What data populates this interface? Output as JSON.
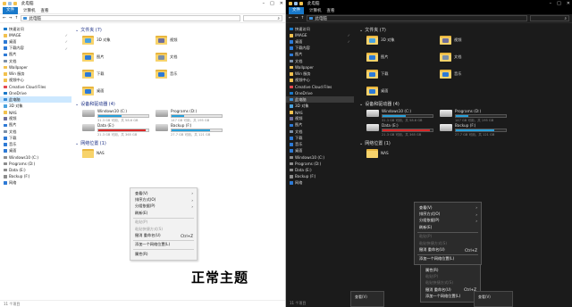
{
  "colors": {
    "accent": "#1979ca",
    "folder": "#f2c14e",
    "drive_bar": "#26a0da",
    "drive_bar_low": "#da2626"
  },
  "light": {
    "title": "此电脑",
    "ribbon_tabs": [
      "文件",
      "计算机",
      "查看"
    ],
    "address": "此电脑",
    "sidebar": [
      {
        "label": "快速访问",
        "icon": "star-icon",
        "color": "#1979ca",
        "pinned": false,
        "selected": false
      },
      {
        "label": "IMAGE",
        "icon": "folder-icon",
        "color": "#f2c14e",
        "pinned": true,
        "selected": false
      },
      {
        "label": "桌面",
        "icon": "desktop-icon",
        "color": "#2d7ad6",
        "pinned": true,
        "selected": false
      },
      {
        "label": "下载内容",
        "icon": "download-icon",
        "color": "#2d7ad6",
        "pinned": true,
        "selected": false
      },
      {
        "label": "图片",
        "icon": "pictures-icon",
        "color": "#2d7ad6",
        "pinned": false,
        "selected": false
      },
      {
        "label": "文档",
        "icon": "documents-icon",
        "color": "#7b8fa8",
        "pinned": false,
        "selected": false
      },
      {
        "label": "Wallpaper",
        "icon": "folder-icon",
        "color": "#f2c14e",
        "pinned": false,
        "selected": false
      },
      {
        "label": "Win 服务",
        "icon": "folder-icon",
        "color": "#f2c14e",
        "pinned": false,
        "selected": false
      },
      {
        "label": "视频中心",
        "icon": "folder-icon",
        "color": "#f2c14e",
        "pinned": false,
        "selected": false
      },
      {
        "label": "Creative Cloud Files",
        "icon": "creative-cloud-icon",
        "color": "#e34850",
        "pinned": false,
        "selected": false
      },
      {
        "label": "OneDrive",
        "icon": "cloud-icon",
        "color": "#1979ca",
        "pinned": false,
        "selected": false
      },
      {
        "label": "此电脑",
        "icon": "computer-icon",
        "color": "#3b8ed8",
        "pinned": false,
        "selected": true
      },
      {
        "label": "3D 对象",
        "icon": "3d-icon",
        "color": "#4aa3df",
        "pinned": false,
        "selected": false
      },
      {
        "label": "NAS",
        "icon": "folder-icon",
        "color": "#f2c14e",
        "pinned": false,
        "selected": false
      },
      {
        "label": "视频",
        "icon": "video-icon",
        "color": "#6f6f9c",
        "pinned": false,
        "selected": false
      },
      {
        "label": "图片",
        "icon": "pictures-icon",
        "color": "#2d7ad6",
        "pinned": false,
        "selected": false
      },
      {
        "label": "文档",
        "icon": "documents-icon",
        "color": "#7b8fa8",
        "pinned": false,
        "selected": false
      },
      {
        "label": "下载",
        "icon": "download-icon",
        "color": "#2d7ad6",
        "pinned": false,
        "selected": false
      },
      {
        "label": "音乐",
        "icon": "music-icon",
        "color": "#2d7ad6",
        "pinned": false,
        "selected": false
      },
      {
        "label": "桌面",
        "icon": "desktop-icon",
        "color": "#2d7ad6",
        "pinned": false,
        "selected": false
      },
      {
        "label": "Windows10 (C:)",
        "icon": "drive-icon",
        "color": "#8c8c8c",
        "pinned": false,
        "selected": false
      },
      {
        "label": "Programs (D:)",
        "icon": "drive-icon",
        "color": "#8c8c8c",
        "pinned": false,
        "selected": false
      },
      {
        "label": "Data (E:)",
        "icon": "drive-icon",
        "color": "#8c8c8c",
        "pinned": false,
        "selected": false
      },
      {
        "label": "Backup (F:)",
        "icon": "drive-icon",
        "color": "#8c8c8c",
        "pinned": false,
        "selected": false
      },
      {
        "label": "网络",
        "icon": "network-icon",
        "color": "#2d7ad6",
        "pinned": false,
        "selected": false
      }
    ],
    "folders_header": "文件夹 (7)",
    "folders": [
      {
        "label": "3D 对象",
        "glyph": "#4aa3df"
      },
      {
        "label": "视频",
        "glyph": "#6f6f9c"
      },
      {
        "label": "图片",
        "glyph": "#2d7ad6"
      },
      {
        "label": "文档",
        "glyph": "#7b8fa8"
      },
      {
        "label": "下载",
        "glyph": "#2d7ad6"
      },
      {
        "label": "音乐",
        "glyph": "#2d7ad6"
      },
      {
        "label": "桌面",
        "glyph": "#2d7ad6"
      }
    ],
    "drives_header": "设备和驱动器 (4)",
    "drives": [
      {
        "label": "Windows10 (C:)",
        "free": "31.3 GB 可用，共 58.6 GB",
        "fill": 0.47,
        "low": false
      },
      {
        "label": "Programs (D:)",
        "free": "147 GB 可用，共 195 GB",
        "fill": 0.25,
        "low": false
      },
      {
        "label": "Data (E:)",
        "free": "21.3 GB 可用，共 365 GB",
        "fill": 0.94,
        "low": true
      },
      {
        "label": "Backup (F:)",
        "free": "27.7 GB 可用，共 121 GB",
        "fill": 0.77,
        "low": false
      }
    ],
    "network_header": "网络位置 (1)",
    "network": [
      {
        "label": "NAS"
      }
    ],
    "status": "11 个项目",
    "context_menu": [
      {
        "label": "查看(V)",
        "sub": true,
        "disabled": false
      },
      {
        "label": "排序方式(O)",
        "sub": true,
        "disabled": false
      },
      {
        "label": "分组依据(P)",
        "sub": true,
        "disabled": false
      },
      {
        "label": "刷新(E)",
        "sub": false,
        "disabled": false
      },
      {
        "sep": true
      },
      {
        "label": "粘贴(P)",
        "sub": false,
        "disabled": true
      },
      {
        "label": "粘贴快捷方式(S)",
        "sub": false,
        "disabled": true
      },
      {
        "label": "撤消 重命名(U)",
        "shortcut": "Ctrl+Z",
        "sub": false,
        "disabled": false
      },
      {
        "sep": true
      },
      {
        "label": "添加一个网络位置(L)",
        "sub": false,
        "disabled": false
      },
      {
        "sep": true
      },
      {
        "label": "属性(R)",
        "sub": false,
        "disabled": false
      }
    ],
    "caption": "正常主题"
  },
  "dark": {
    "title": "此电脑",
    "ribbon_tabs": [
      "文件",
      "计算机",
      "查看"
    ],
    "address": "此电脑",
    "sidebar": [
      {
        "label": "快速访问",
        "icon": "star-icon",
        "color": "#1979ca",
        "pinned": false,
        "selected": false
      },
      {
        "label": "IMAGE",
        "icon": "folder-icon",
        "color": "#f2c14e",
        "pinned": true,
        "selected": false
      },
      {
        "label": "桌面",
        "icon": "desktop-icon",
        "color": "#2d7ad6",
        "pinned": true,
        "selected": false
      },
      {
        "label": "下载内容",
        "icon": "download-icon",
        "color": "#2d7ad6",
        "pinned": false,
        "selected": false
      },
      {
        "label": "图片",
        "icon": "pictures-icon",
        "color": "#2d7ad6",
        "pinned": false,
        "selected": false
      },
      {
        "label": "文档",
        "icon": "documents-icon",
        "color": "#7b8fa8",
        "pinned": false,
        "selected": false
      },
      {
        "label": "Wallpaper",
        "icon": "folder-icon",
        "color": "#f2c14e",
        "pinned": false,
        "selected": false
      },
      {
        "label": "Win 服务",
        "icon": "folder-icon",
        "color": "#f2c14e",
        "pinned": false,
        "selected": false
      },
      {
        "label": "视频中心",
        "icon": "folder-icon",
        "color": "#f2c14e",
        "pinned": false,
        "selected": false
      },
      {
        "label": "Creative Cloud Files",
        "icon": "creative-cloud-icon",
        "color": "#e34850",
        "pinned": false,
        "selected": false
      },
      {
        "label": "OneDrive",
        "icon": "cloud-icon",
        "color": "#1979ca",
        "pinned": false,
        "selected": false
      },
      {
        "label": "此电脑",
        "icon": "computer-icon",
        "color": "#3b8ed8",
        "pinned": false,
        "selected": true
      },
      {
        "label": "3D 对象",
        "icon": "3d-icon",
        "color": "#4aa3df",
        "pinned": false,
        "selected": false
      },
      {
        "label": "NAS",
        "icon": "folder-icon",
        "color": "#f2c14e",
        "pinned": false,
        "selected": false
      },
      {
        "label": "视频",
        "icon": "video-icon",
        "color": "#6f6f9c",
        "pinned": false,
        "selected": false
      },
      {
        "label": "图片",
        "icon": "pictures-icon",
        "color": "#2d7ad6",
        "pinned": false,
        "selected": false
      },
      {
        "label": "文档",
        "icon": "documents-icon",
        "color": "#7b8fa8",
        "pinned": false,
        "selected": false
      },
      {
        "label": "下载",
        "icon": "download-icon",
        "color": "#2d7ad6",
        "pinned": false,
        "selected": false
      },
      {
        "label": "音乐",
        "icon": "music-icon",
        "color": "#2d7ad6",
        "pinned": false,
        "selected": false
      },
      {
        "label": "桌面",
        "icon": "desktop-icon",
        "color": "#2d7ad6",
        "pinned": false,
        "selected": false
      },
      {
        "label": "Windows10 (C:)",
        "icon": "drive-icon",
        "color": "#8c8c8c",
        "pinned": false,
        "selected": false
      },
      {
        "label": "Programs (D:)",
        "icon": "drive-icon",
        "color": "#8c8c8c",
        "pinned": false,
        "selected": false
      },
      {
        "label": "Data (E:)",
        "icon": "drive-icon",
        "color": "#8c8c8c",
        "pinned": false,
        "selected": false
      },
      {
        "label": "Backup (F:)",
        "icon": "drive-icon",
        "color": "#8c8c8c",
        "pinned": false,
        "selected": false
      },
      {
        "label": "网络",
        "icon": "network-icon",
        "color": "#2d7ad6",
        "pinned": false,
        "selected": false
      }
    ],
    "folders_header": "文件夹 (7)",
    "folders": [
      {
        "label": "3D 对象",
        "glyph": "#4aa3df"
      },
      {
        "label": "视频",
        "glyph": "#6f6f9c"
      },
      {
        "label": "图片",
        "glyph": "#2d7ad6"
      },
      {
        "label": "文档",
        "glyph": "#7b8fa8"
      },
      {
        "label": "下载",
        "glyph": "#2d7ad6"
      },
      {
        "label": "音乐",
        "glyph": "#2d7ad6"
      },
      {
        "label": "桌面",
        "glyph": "#2d7ad6"
      }
    ],
    "drives_header": "设备和驱动器 (4)",
    "drives": [
      {
        "label": "Windows10 (C:)",
        "free": "31.3 GB 可用，共 58.6 GB",
        "fill": 0.47,
        "low": false
      },
      {
        "label": "Programs (D:)",
        "free": "147 GB 可用，共 195 GB",
        "fill": 0.25,
        "low": false
      },
      {
        "label": "Data (E:)",
        "free": "21.3 GB 可用，共 365 GB",
        "fill": 0.94,
        "low": true
      },
      {
        "label": "Backup (F:)",
        "free": "27.7 GB 可用，共 121 GB",
        "fill": 0.77,
        "low": false
      }
    ],
    "network_header": "网络位置 (1)",
    "network": [
      {
        "label": "NAS"
      }
    ],
    "status": "11 个项目",
    "context_menu": [
      {
        "label": "查看(V)",
        "sub": true,
        "disabled": false
      },
      {
        "label": "排序方式(O)",
        "sub": true,
        "disabled": false
      },
      {
        "label": "分组依据(P)",
        "sub": true,
        "disabled": false
      },
      {
        "label": "刷新(E)",
        "sub": false,
        "disabled": false
      },
      {
        "sep": true
      },
      {
        "label": "粘贴(P)",
        "sub": false,
        "disabled": true
      },
      {
        "label": "粘贴快捷方式(S)",
        "sub": false,
        "disabled": true
      },
      {
        "label": "撤消 重命名(U)",
        "shortcut": "Ctrl+Z",
        "sub": false,
        "disabled": false
      },
      {
        "sep": true
      },
      {
        "label": "添加一个网络位置(L)",
        "sub": false,
        "disabled": false
      }
    ],
    "context_menu_2": [
      {
        "label": "属性(R)",
        "sub": false,
        "disabled": false
      },
      {
        "label": "粘贴(P)",
        "sub": false,
        "disabled": true
      },
      {
        "label": "粘贴快捷方式(S)",
        "sub": false,
        "disabled": true
      },
      {
        "label": "撤消 重命名(U)",
        "shortcut": "Ctrl+Z",
        "sub": false,
        "disabled": false
      },
      {
        "label": "添加一个网络位置(L)",
        "sub": false,
        "disabled": false
      }
    ],
    "mini_menus": [
      "查看(V)",
      "查看(V)"
    ]
  }
}
